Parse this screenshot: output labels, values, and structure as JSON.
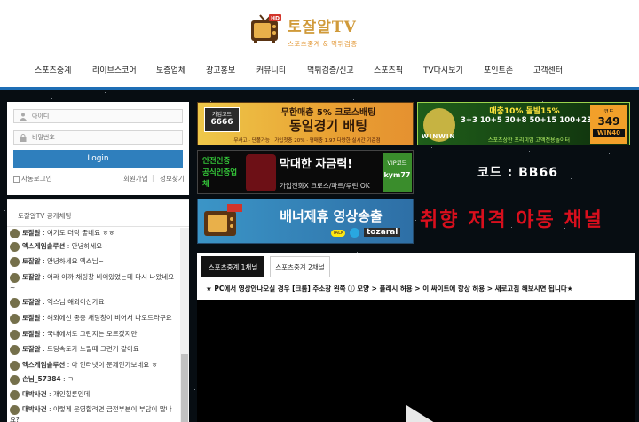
{
  "logo": {
    "title": "토잘알TV",
    "subtitle": "스포츠중계 & 먹튀검증",
    "badge": "HD"
  },
  "nav": [
    "스포츠중계",
    "라이브스코어",
    "보증업체",
    "광고홍보",
    "커뮤니티",
    "먹튀검증/신고",
    "스포츠픽",
    "TV다시보기",
    "포인트존",
    "고객센터"
  ],
  "login": {
    "id_placeholder": "아이디",
    "pw_placeholder": "비밀번호",
    "button": "Login",
    "auto_login": "자동로그인",
    "join": "회원가입",
    "divider": "|",
    "find": "정보찾기"
  },
  "chat": {
    "title": "토잘알TV 공개채팅",
    "messages": [
      {
        "name": "토잘알",
        "text": ": 여기도 더락 좋네요 ㅎㅎ"
      },
      {
        "name": "엑스게임솔루션",
        "text": ": 안녕하세요~"
      },
      {
        "name": "토잘알",
        "text": ": 안녕하세요 엑스님~"
      },
      {
        "name": "토잘알",
        "text": ": 어라 아까 채팅창 비어있었는데 다시 나왔네요~"
      },
      {
        "name": "토잘알",
        "text": ": 엑스님 해외이신가요"
      },
      {
        "name": "토잘알",
        "text": ": 해외에선 종종 채팅창이 비어서 나오드라구요"
      },
      {
        "name": "토잘알",
        "text": ": 국내에서도 그런지는 모르겠지만"
      },
      {
        "name": "토잘알",
        "text": ": 트딩속도가 느릴때 그런거 같아요"
      },
      {
        "name": "엑스게임솔루션",
        "text": ": 아 인터넷이 문제인가보네요 ㅎ"
      },
      {
        "name": "손님_57384",
        "text": ": ㅋ"
      },
      {
        "name": "대박사건",
        "text": ": 개인힐론인데"
      },
      {
        "name": "대박사건",
        "text": ": 이렇게 운영할려면 금전부분이 부담이 많나요?"
      }
    ]
  },
  "banners": {
    "b1": {
      "code_label": "가입코드",
      "code": "6666",
      "line1": "무한매충 5% 크로스배팅",
      "line2": "동일경기 배팅",
      "line3": "무사고 · 단폴가능 · 가입첫충 20% · 평매충 1.97 다양한 실시간 기준점"
    },
    "b2": {
      "top": "매충10% 돌발15%",
      "mid": "3+3 10+5 30+8 50+15 100+23",
      "brand": "WINWIN",
      "bottom": "스포츠상한 프리미엄 고액전용놀이터",
      "code_label": "코드",
      "code": "349",
      "code2": "WIN40"
    },
    "b3": {
      "left": "안전인증 공식인증업체",
      "main": "막대한 자금력!",
      "vip": "VIP코드",
      "vip_code": "kym77",
      "sub": "가입전화X 크로스/파트/루틴 OK"
    },
    "b4": {
      "main": "배너제휴 영상송출",
      "handle": "tozaral",
      "talk": "TALK"
    },
    "code_text": "코드 : BB66",
    "neon_text": "취향 저격 야동 채널"
  },
  "tabs": [
    "스포츠중계 1채널",
    "스포츠중계 2채널"
  ],
  "notice": "★ PC에서 영상안나오실 경우 [크롬] 주소창 왼쪽 ⓘ 모양 > 플래시 허용 > 이 싸이트에 항상 허용 > 새로고침 해보시면 됩니다★",
  "colors": {
    "accent": "#1e6eb5",
    "login_button": "#2f7fbd",
    "logo": "#d09a3a",
    "neon": "#d90f1d"
  }
}
